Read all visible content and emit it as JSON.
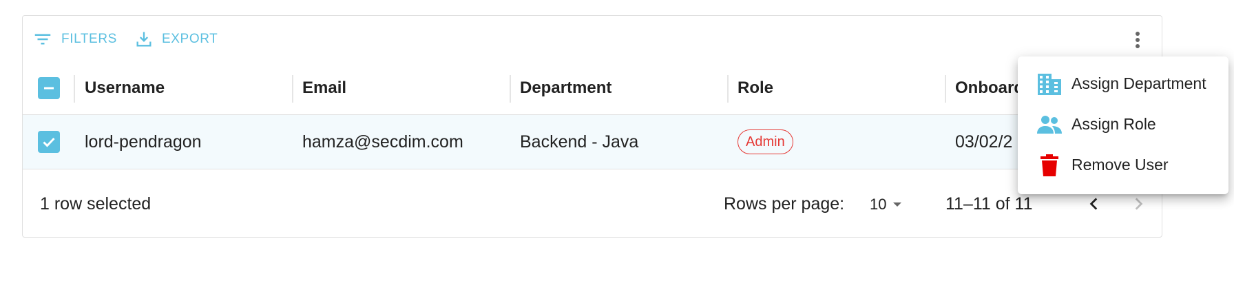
{
  "toolbar": {
    "filters_label": "FILTERS",
    "export_label": "EXPORT"
  },
  "table": {
    "columns": [
      "Username",
      "Email",
      "Department",
      "Role",
      "Onboarded"
    ],
    "rows": [
      {
        "username": "lord-pendragon",
        "email": "hamza@secdim.com",
        "department": "Backend - Java",
        "role": "Admin",
        "onboarded": "03/02/2"
      }
    ]
  },
  "footer": {
    "selection": "1 row selected",
    "rows_per_page_label": "Rows per page:",
    "rows_per_page_value": "10",
    "range": "11–11 of 11"
  },
  "menu": {
    "items": [
      {
        "label": "Assign Department",
        "icon": "building-icon"
      },
      {
        "label": "Assign Role",
        "icon": "people-icon"
      },
      {
        "label": "Remove User",
        "icon": "trash-icon"
      }
    ]
  },
  "colors": {
    "accent": "#5bbfe0",
    "danger": "#e53935",
    "trash": "#e60000",
    "selected_row_bg": "#f3fafd"
  }
}
